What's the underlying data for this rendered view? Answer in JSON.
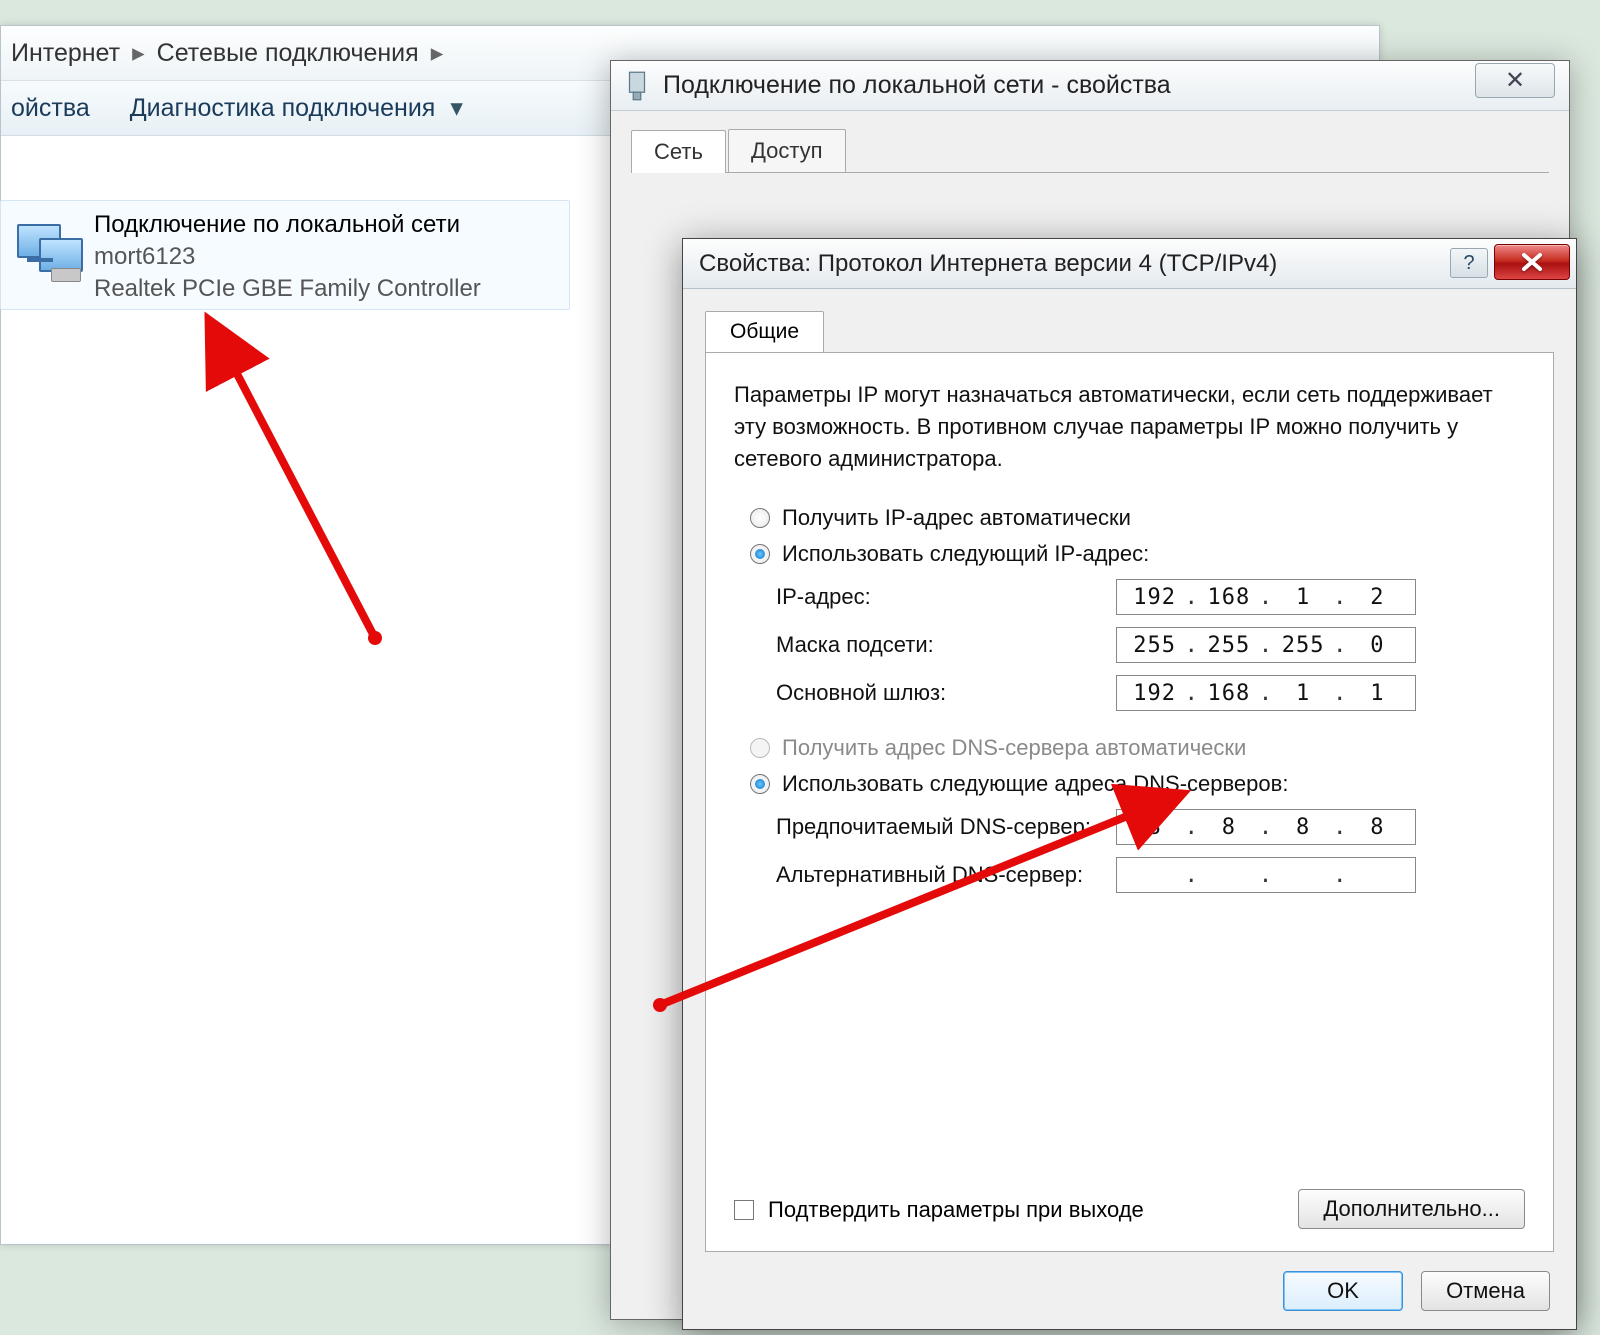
{
  "explorer": {
    "crumb1": "Интернет",
    "crumb2": "Сетевые подключения",
    "tool1": "ойства",
    "tool2": "Диагностика подключения"
  },
  "connection": {
    "title": "Подключение по локальной сети",
    "net": "mort6123",
    "adapter": "Realtek PCIe GBE Family Controller"
  },
  "dlg1": {
    "title": "Подключение по локальной сети - свойства",
    "tab_network": "Сеть",
    "tab_access": "Доступ",
    "close_glyph": "✕"
  },
  "dlg2": {
    "title": "Свойства: Протокол Интернета версии 4 (TCP/IPv4)",
    "help": "?",
    "tab_general": "Общие",
    "desc": "Параметры IP могут назначаться автоматически, если сеть поддерживает эту возможность. В противном случае параметры IP можно получить у сетевого администратора.",
    "r_auto_ip": "Получить IP-адрес автоматически",
    "r_manual_ip": "Использовать следующий IP-адрес:",
    "l_ip": "IP-адрес:",
    "l_mask": "Маска подсети:",
    "l_gw": "Основной шлюз:",
    "r_auto_dns": "Получить адрес DNS-сервера автоматически",
    "r_manual_dns": "Использовать следующие адреса DNS-серверов:",
    "l_dns1": "Предпочитаемый DNS-сервер:",
    "l_dns2": "Альтернативный DNS-сервер:",
    "confirm": "Подтвердить параметры при выходе",
    "advanced": "Дополнительно...",
    "ok": "OK",
    "cancel": "Отмена",
    "ip": [
      "192",
      "168",
      "1",
      "2"
    ],
    "mask": [
      "255",
      "255",
      "255",
      "0"
    ],
    "gw": [
      "192",
      "168",
      "1",
      "1"
    ],
    "dns1": [
      "8",
      "8",
      "8",
      "8"
    ],
    "dns2": [
      "",
      "",
      "",
      ""
    ]
  }
}
